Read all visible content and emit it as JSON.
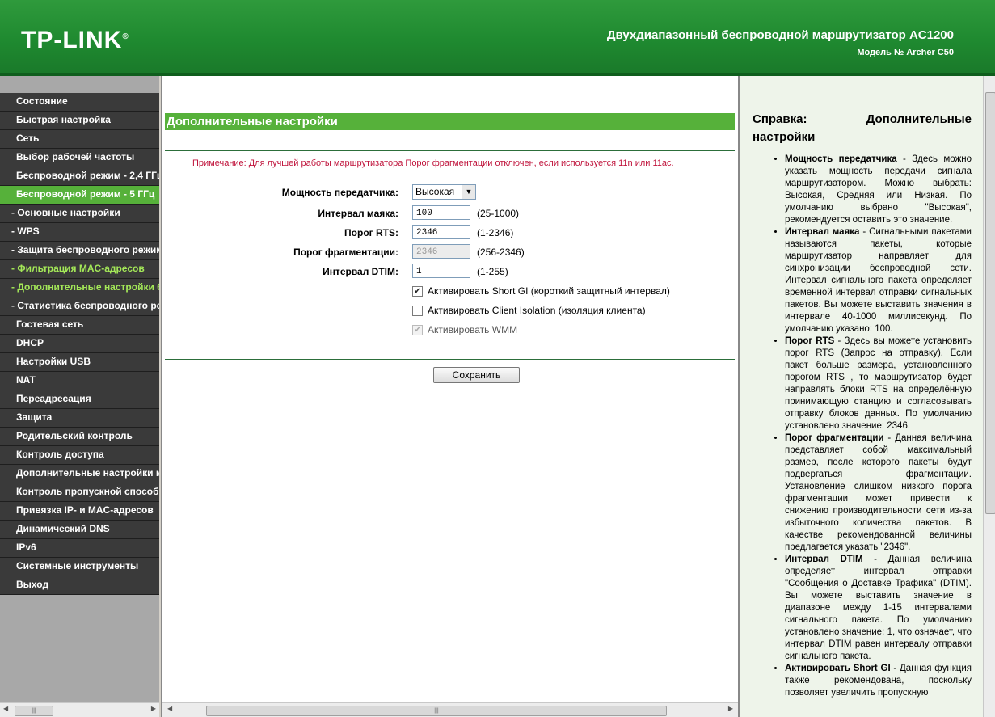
{
  "header": {
    "logo": "TP-LINK",
    "router_title": "Двухдиапазонный беспроводной маршрутизатор AC1200",
    "router_model": "Модель № Archer C50"
  },
  "menu": {
    "items": [
      {
        "label": "Состояние"
      },
      {
        "label": "Быстрая настройка"
      },
      {
        "label": "Сеть"
      },
      {
        "label": "Выбор рабочей частоты"
      },
      {
        "label": "Беспроводной режим - 2,4 ГГц"
      },
      {
        "label": "Беспроводной режим - 5 ГГц"
      },
      {
        "label": "- Основные настройки"
      },
      {
        "label": "- WPS"
      },
      {
        "label": "- Защита беспроводного режима"
      },
      {
        "label": "- Фильтрация MAC-адресов"
      },
      {
        "label": "- Дополнительные настройки беспроводного режима"
      },
      {
        "label": "- Статистика беспроводного режима"
      },
      {
        "label": "Гостевая сеть"
      },
      {
        "label": "DHCP"
      },
      {
        "label": "Настройки USB"
      },
      {
        "label": "NAT"
      },
      {
        "label": "Переадресация"
      },
      {
        "label": "Защита"
      },
      {
        "label": "Родительский контроль"
      },
      {
        "label": "Контроль доступа"
      },
      {
        "label": "Дополнительные настройки маршрутизации"
      },
      {
        "label": "Контроль пропускной способности"
      },
      {
        "label": "Привязка IP- и MAC-адресов"
      },
      {
        "label": "Динамический DNS"
      },
      {
        "label": "IPv6"
      },
      {
        "label": "Системные инструменты"
      },
      {
        "label": "Выход"
      }
    ]
  },
  "main": {
    "section_title": "Дополнительные настройки",
    "note": "Примечание: Для лучшей работы маршрутизатора Порог фрагментации отключен, если используется 11n или 11ac.",
    "tx_power": {
      "label": "Мощность передатчика:",
      "value": "Высокая"
    },
    "beacon": {
      "label": "Интервал маяка:",
      "value": "100",
      "range": "(25-1000)"
    },
    "rts": {
      "label": "Порог RTS:",
      "value": "2346",
      "range": "(1-2346)"
    },
    "frag": {
      "label": "Порог фрагментации:",
      "value": "2346",
      "range": "(256-2346)"
    },
    "dtim": {
      "label": "Интервал DTIM:",
      "value": "1",
      "range": "(1-255)"
    },
    "short_gi": {
      "label": "Активировать Short GI (короткий защитный интервал)",
      "checked": true
    },
    "client_isolation": {
      "label": "Активировать Client Isolation (изоляция клиента)",
      "checked": false
    },
    "wmm": {
      "label": "Активировать WMM",
      "checked": true
    },
    "save_label": "Сохранить"
  },
  "help": {
    "title_1": "Справка:",
    "title_2": "Дополнительные",
    "title_3": "настройки",
    "items": [
      {
        "term": "Мощность передатчика",
        "text": " - Здесь можно указать мощность передачи сигнала маршрутизатором. Можно выбрать: Высокая, Средняя или Низкая. По умолчанию выбрано \"Высокая\", рекомендуется оставить это значение."
      },
      {
        "term": "Интервал маяка",
        "text": " - Сигнальными пакетами называются пакеты, которые маршрутизатор направляет для синхронизации беспроводной сети. Интервал сигнального пакета определяет временной интервал отправки сигнальных пакетов. Вы можете выставить значения в интервале 40-1000 миллисекунд. По умолчанию указано: 100."
      },
      {
        "term": "Порог RTS",
        "text": " - Здесь вы можете установить порог RTS (Запрос на отправку). Если пакет больше размера, установленного порогом RTS , то маршрутизатор будет направлять блоки RTS на определённую принимающую станцию и согласовывать отправку блоков данных. По умолчанию установлено значение: 2346."
      },
      {
        "term": "Порог фрагментации",
        "text": " - Данная величина представляет собой максимальный размер, после которого пакеты будут подвергаться фрагментации. Установление слишком низкого порога фрагментации может привести к снижению производительности сети из-за избыточного количества пакетов. В качестве рекомендованной величины предлагается указать \"2346\"."
      },
      {
        "term": "Интервал DTIM",
        "text": " - Данная величина определяет интервал отправки \"Сообщения о Доставке Трафика\" (DTIM). Вы можете выставить значение в диапазоне между 1-15 интервалами сигнального пакета. По умолчанию установлено значение: 1, что означает, что интервал DTIM равен интервалу отправки сигнального пакета."
      },
      {
        "term": "Активировать Short GI",
        "text": " - Данная функция также рекомендована, поскольку позволяет увеличить пропускную"
      }
    ]
  }
}
